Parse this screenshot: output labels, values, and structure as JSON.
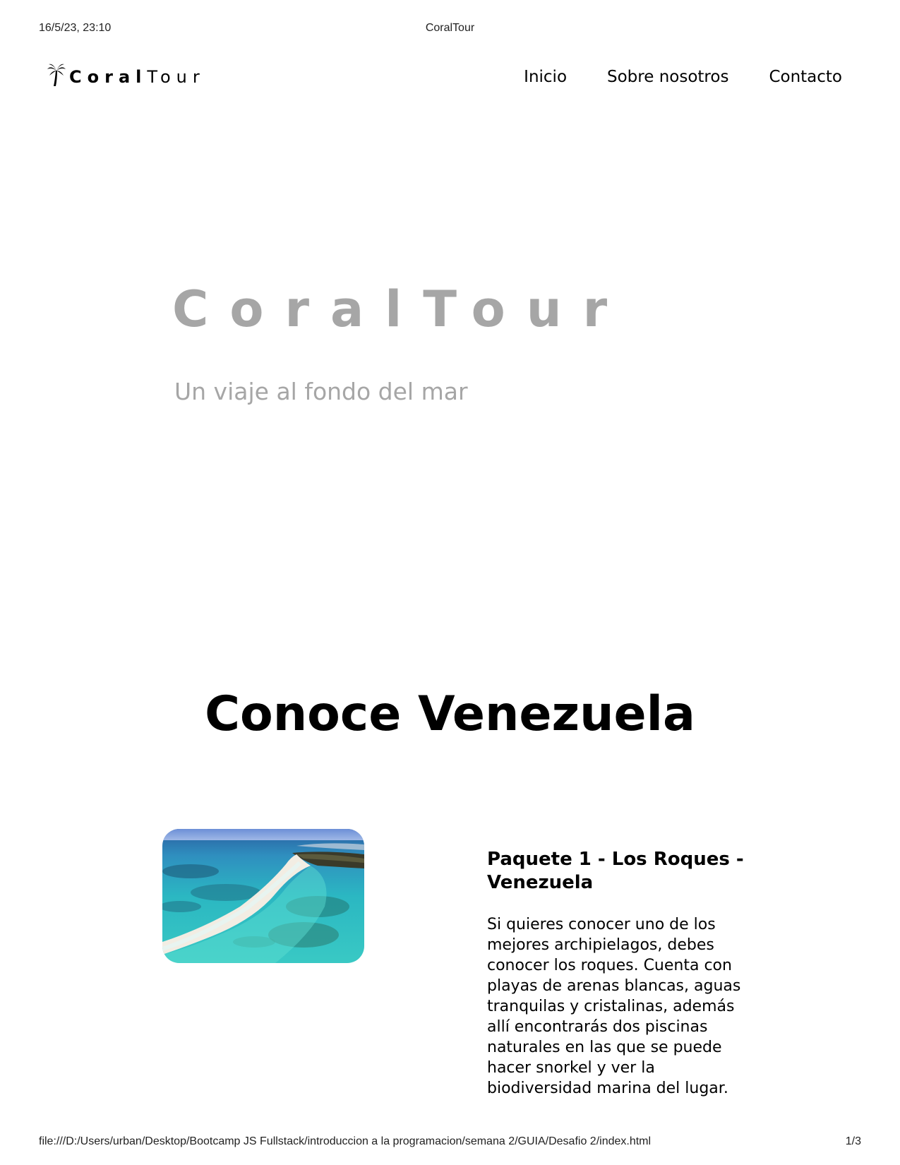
{
  "print": {
    "date": "16/5/23, 23:10",
    "title": "CoralTour",
    "url": "file:///D:/Users/urban/Desktop/Bootcamp JS Fullstack/introduccion a la programacion/semana 2/GUIA/Desafio 2/index.html",
    "page": "1/3"
  },
  "navbar": {
    "logo_bold": "Coral",
    "logo_light": "Tour",
    "logo_icon": "palm-tree-icon",
    "links": [
      "Inicio",
      "Sobre nosotros",
      "Contacto"
    ]
  },
  "hero": {
    "title": "CoralTour",
    "subtitle": "Un viaje al fondo del mar",
    "text_color": "#a6a6a6"
  },
  "section": {
    "title": "Conoce Venezuela",
    "cards": [
      {
        "title": "Paquete 1 - Los Roques - Venezuela",
        "text": "Si quieres conocer uno de los mejores archipielagos, debes conocer los roques. Cuenta con playas de arenas blancas, aguas tranquilas y cristalinas, además allí encontrarás dos piscinas naturales en las que se puede hacer snorkel y ver la biodiversidad marina del lugar."
      }
    ]
  }
}
